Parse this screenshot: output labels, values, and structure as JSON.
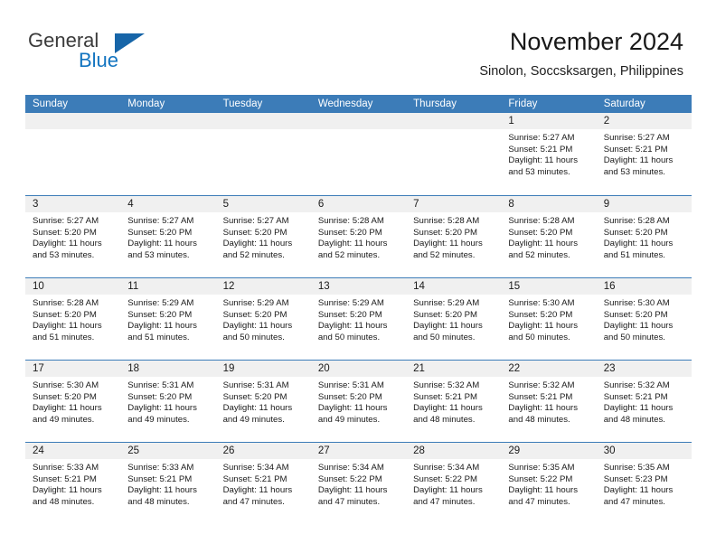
{
  "brand": {
    "name_top": "General",
    "name_bottom": "Blue",
    "color_dark": "#3b3b3b",
    "color_blue": "#1274c0",
    "triangle_color": "#1765a8"
  },
  "header": {
    "title": "November 2024",
    "subtitle": "Sinolon, Soccsksargen, Philippines"
  },
  "theme": {
    "header_bar_color": "#3c7cb8",
    "daynum_band_color": "#f0f0f0",
    "row_divider_color": "#3c7cb8",
    "text_color": "#1a1a1a"
  },
  "weekdays": [
    "Sunday",
    "Monday",
    "Tuesday",
    "Wednesday",
    "Thursday",
    "Friday",
    "Saturday"
  ],
  "labels": {
    "sunrise_prefix": "Sunrise:",
    "sunset_prefix": "Sunset:",
    "daylight_prefix": "Daylight:"
  },
  "weeks": [
    [
      {
        "day": "",
        "sunrise": "",
        "sunset": "",
        "daylight": "",
        "empty": true
      },
      {
        "day": "",
        "sunrise": "",
        "sunset": "",
        "daylight": "",
        "empty": true
      },
      {
        "day": "",
        "sunrise": "",
        "sunset": "",
        "daylight": "",
        "empty": true
      },
      {
        "day": "",
        "sunrise": "",
        "sunset": "",
        "daylight": "",
        "empty": true
      },
      {
        "day": "",
        "sunrise": "",
        "sunset": "",
        "daylight": "",
        "empty": true
      },
      {
        "day": "1",
        "sunrise": "Sunrise: 5:27 AM",
        "sunset": "Sunset: 5:21 PM",
        "daylight": "Daylight: 11 hours and 53 minutes."
      },
      {
        "day": "2",
        "sunrise": "Sunrise: 5:27 AM",
        "sunset": "Sunset: 5:21 PM",
        "daylight": "Daylight: 11 hours and 53 minutes."
      }
    ],
    [
      {
        "day": "3",
        "sunrise": "Sunrise: 5:27 AM",
        "sunset": "Sunset: 5:20 PM",
        "daylight": "Daylight: 11 hours and 53 minutes."
      },
      {
        "day": "4",
        "sunrise": "Sunrise: 5:27 AM",
        "sunset": "Sunset: 5:20 PM",
        "daylight": "Daylight: 11 hours and 53 minutes."
      },
      {
        "day": "5",
        "sunrise": "Sunrise: 5:27 AM",
        "sunset": "Sunset: 5:20 PM",
        "daylight": "Daylight: 11 hours and 52 minutes."
      },
      {
        "day": "6",
        "sunrise": "Sunrise: 5:28 AM",
        "sunset": "Sunset: 5:20 PM",
        "daylight": "Daylight: 11 hours and 52 minutes."
      },
      {
        "day": "7",
        "sunrise": "Sunrise: 5:28 AM",
        "sunset": "Sunset: 5:20 PM",
        "daylight": "Daylight: 11 hours and 52 minutes."
      },
      {
        "day": "8",
        "sunrise": "Sunrise: 5:28 AM",
        "sunset": "Sunset: 5:20 PM",
        "daylight": "Daylight: 11 hours and 52 minutes."
      },
      {
        "day": "9",
        "sunrise": "Sunrise: 5:28 AM",
        "sunset": "Sunset: 5:20 PM",
        "daylight": "Daylight: 11 hours and 51 minutes."
      }
    ],
    [
      {
        "day": "10",
        "sunrise": "Sunrise: 5:28 AM",
        "sunset": "Sunset: 5:20 PM",
        "daylight": "Daylight: 11 hours and 51 minutes."
      },
      {
        "day": "11",
        "sunrise": "Sunrise: 5:29 AM",
        "sunset": "Sunset: 5:20 PM",
        "daylight": "Daylight: 11 hours and 51 minutes."
      },
      {
        "day": "12",
        "sunrise": "Sunrise: 5:29 AM",
        "sunset": "Sunset: 5:20 PM",
        "daylight": "Daylight: 11 hours and 50 minutes."
      },
      {
        "day": "13",
        "sunrise": "Sunrise: 5:29 AM",
        "sunset": "Sunset: 5:20 PM",
        "daylight": "Daylight: 11 hours and 50 minutes."
      },
      {
        "day": "14",
        "sunrise": "Sunrise: 5:29 AM",
        "sunset": "Sunset: 5:20 PM",
        "daylight": "Daylight: 11 hours and 50 minutes."
      },
      {
        "day": "15",
        "sunrise": "Sunrise: 5:30 AM",
        "sunset": "Sunset: 5:20 PM",
        "daylight": "Daylight: 11 hours and 50 minutes."
      },
      {
        "day": "16",
        "sunrise": "Sunrise: 5:30 AM",
        "sunset": "Sunset: 5:20 PM",
        "daylight": "Daylight: 11 hours and 50 minutes."
      }
    ],
    [
      {
        "day": "17",
        "sunrise": "Sunrise: 5:30 AM",
        "sunset": "Sunset: 5:20 PM",
        "daylight": "Daylight: 11 hours and 49 minutes."
      },
      {
        "day": "18",
        "sunrise": "Sunrise: 5:31 AM",
        "sunset": "Sunset: 5:20 PM",
        "daylight": "Daylight: 11 hours and 49 minutes."
      },
      {
        "day": "19",
        "sunrise": "Sunrise: 5:31 AM",
        "sunset": "Sunset: 5:20 PM",
        "daylight": "Daylight: 11 hours and 49 minutes."
      },
      {
        "day": "20",
        "sunrise": "Sunrise: 5:31 AM",
        "sunset": "Sunset: 5:20 PM",
        "daylight": "Daylight: 11 hours and 49 minutes."
      },
      {
        "day": "21",
        "sunrise": "Sunrise: 5:32 AM",
        "sunset": "Sunset: 5:21 PM",
        "daylight": "Daylight: 11 hours and 48 minutes."
      },
      {
        "day": "22",
        "sunrise": "Sunrise: 5:32 AM",
        "sunset": "Sunset: 5:21 PM",
        "daylight": "Daylight: 11 hours and 48 minutes."
      },
      {
        "day": "23",
        "sunrise": "Sunrise: 5:32 AM",
        "sunset": "Sunset: 5:21 PM",
        "daylight": "Daylight: 11 hours and 48 minutes."
      }
    ],
    [
      {
        "day": "24",
        "sunrise": "Sunrise: 5:33 AM",
        "sunset": "Sunset: 5:21 PM",
        "daylight": "Daylight: 11 hours and 48 minutes."
      },
      {
        "day": "25",
        "sunrise": "Sunrise: 5:33 AM",
        "sunset": "Sunset: 5:21 PM",
        "daylight": "Daylight: 11 hours and 48 minutes."
      },
      {
        "day": "26",
        "sunrise": "Sunrise: 5:34 AM",
        "sunset": "Sunset: 5:21 PM",
        "daylight": "Daylight: 11 hours and 47 minutes."
      },
      {
        "day": "27",
        "sunrise": "Sunrise: 5:34 AM",
        "sunset": "Sunset: 5:22 PM",
        "daylight": "Daylight: 11 hours and 47 minutes."
      },
      {
        "day": "28",
        "sunrise": "Sunrise: 5:34 AM",
        "sunset": "Sunset: 5:22 PM",
        "daylight": "Daylight: 11 hours and 47 minutes."
      },
      {
        "day": "29",
        "sunrise": "Sunrise: 5:35 AM",
        "sunset": "Sunset: 5:22 PM",
        "daylight": "Daylight: 11 hours and 47 minutes."
      },
      {
        "day": "30",
        "sunrise": "Sunrise: 5:35 AM",
        "sunset": "Sunset: 5:23 PM",
        "daylight": "Daylight: 11 hours and 47 minutes."
      }
    ]
  ]
}
